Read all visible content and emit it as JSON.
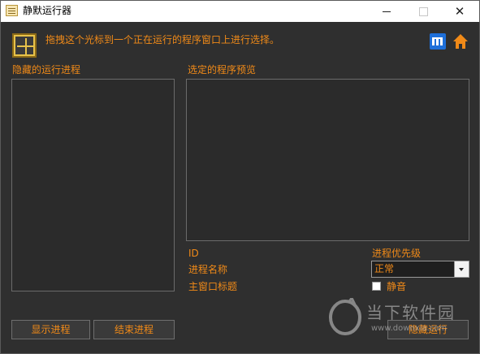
{
  "window": {
    "title": "静默运行器",
    "min_icon": "minimize-icon",
    "max_icon": "maximize-icon",
    "close_icon": "close-icon",
    "close_glyph": "✕"
  },
  "toolbar": {
    "instruction": "拖拽这个光标到一个正在运行的程序窗口上进行选择。",
    "crosshair_icon": "crosshair-icon",
    "info_icon": "info-icon",
    "home_icon": "home-icon"
  },
  "panels": {
    "hidden_processes_label": "隐藏的运行进程",
    "preview_label": "选定的程序预览"
  },
  "details": {
    "id_label": "ID",
    "process_name_label": "进程名称",
    "main_window_title_label": "主窗口标题",
    "priority_label": "进程优先级",
    "priority_value": "正常",
    "mute_label": "静音",
    "mute_checked": false
  },
  "buttons": {
    "show_process": "显示进程",
    "kill_process": "结束进程",
    "hide_run": "隐藏运行"
  },
  "watermark": {
    "text": "当下软件园",
    "url": "www.downxia.com"
  },
  "colors": {
    "accent": "#f08a18",
    "background": "#2f2f2f",
    "info_icon": "#1e6fd9",
    "home_icon": "#f08a18"
  }
}
